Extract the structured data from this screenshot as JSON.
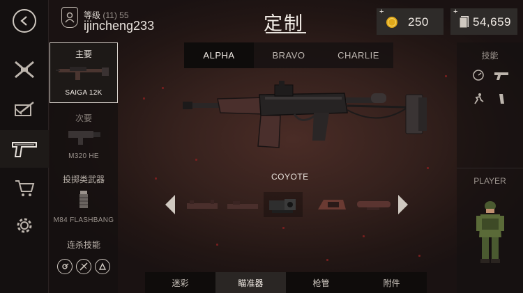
{
  "header": {
    "title": "定制",
    "level_label": "等级",
    "level_value": "(11) 55",
    "username": "ijincheng233"
  },
  "currency": {
    "gold": "250",
    "cash": "54,659",
    "plus": "+"
  },
  "tabs": [
    {
      "label": "ALPHA",
      "active": true
    },
    {
      "label": "BRAVO",
      "active": false
    },
    {
      "label": "CHARLIE",
      "active": false
    }
  ],
  "loadout": {
    "primary": {
      "title": "主要",
      "name": "SAIGA 12K"
    },
    "secondary": {
      "title": "次要",
      "name": "M320 HE"
    },
    "throwable": {
      "title": "投掷类武器",
      "name": "M84 FLASHBANG"
    },
    "killstreak": {
      "title": "连杀技能"
    }
  },
  "right_panel": {
    "skills_label": "技能",
    "player_label": "PLAYER"
  },
  "weapon": {
    "variant": "COYOTE"
  },
  "categories": [
    {
      "label": "迷彩",
      "active": false
    },
    {
      "label": "瞄准器",
      "active": true
    },
    {
      "label": "枪管",
      "active": false
    },
    {
      "label": "附件",
      "active": false
    }
  ],
  "colors": {
    "background": "#221614",
    "accent_red": "#8a2020",
    "gold": "#e0a81a"
  }
}
